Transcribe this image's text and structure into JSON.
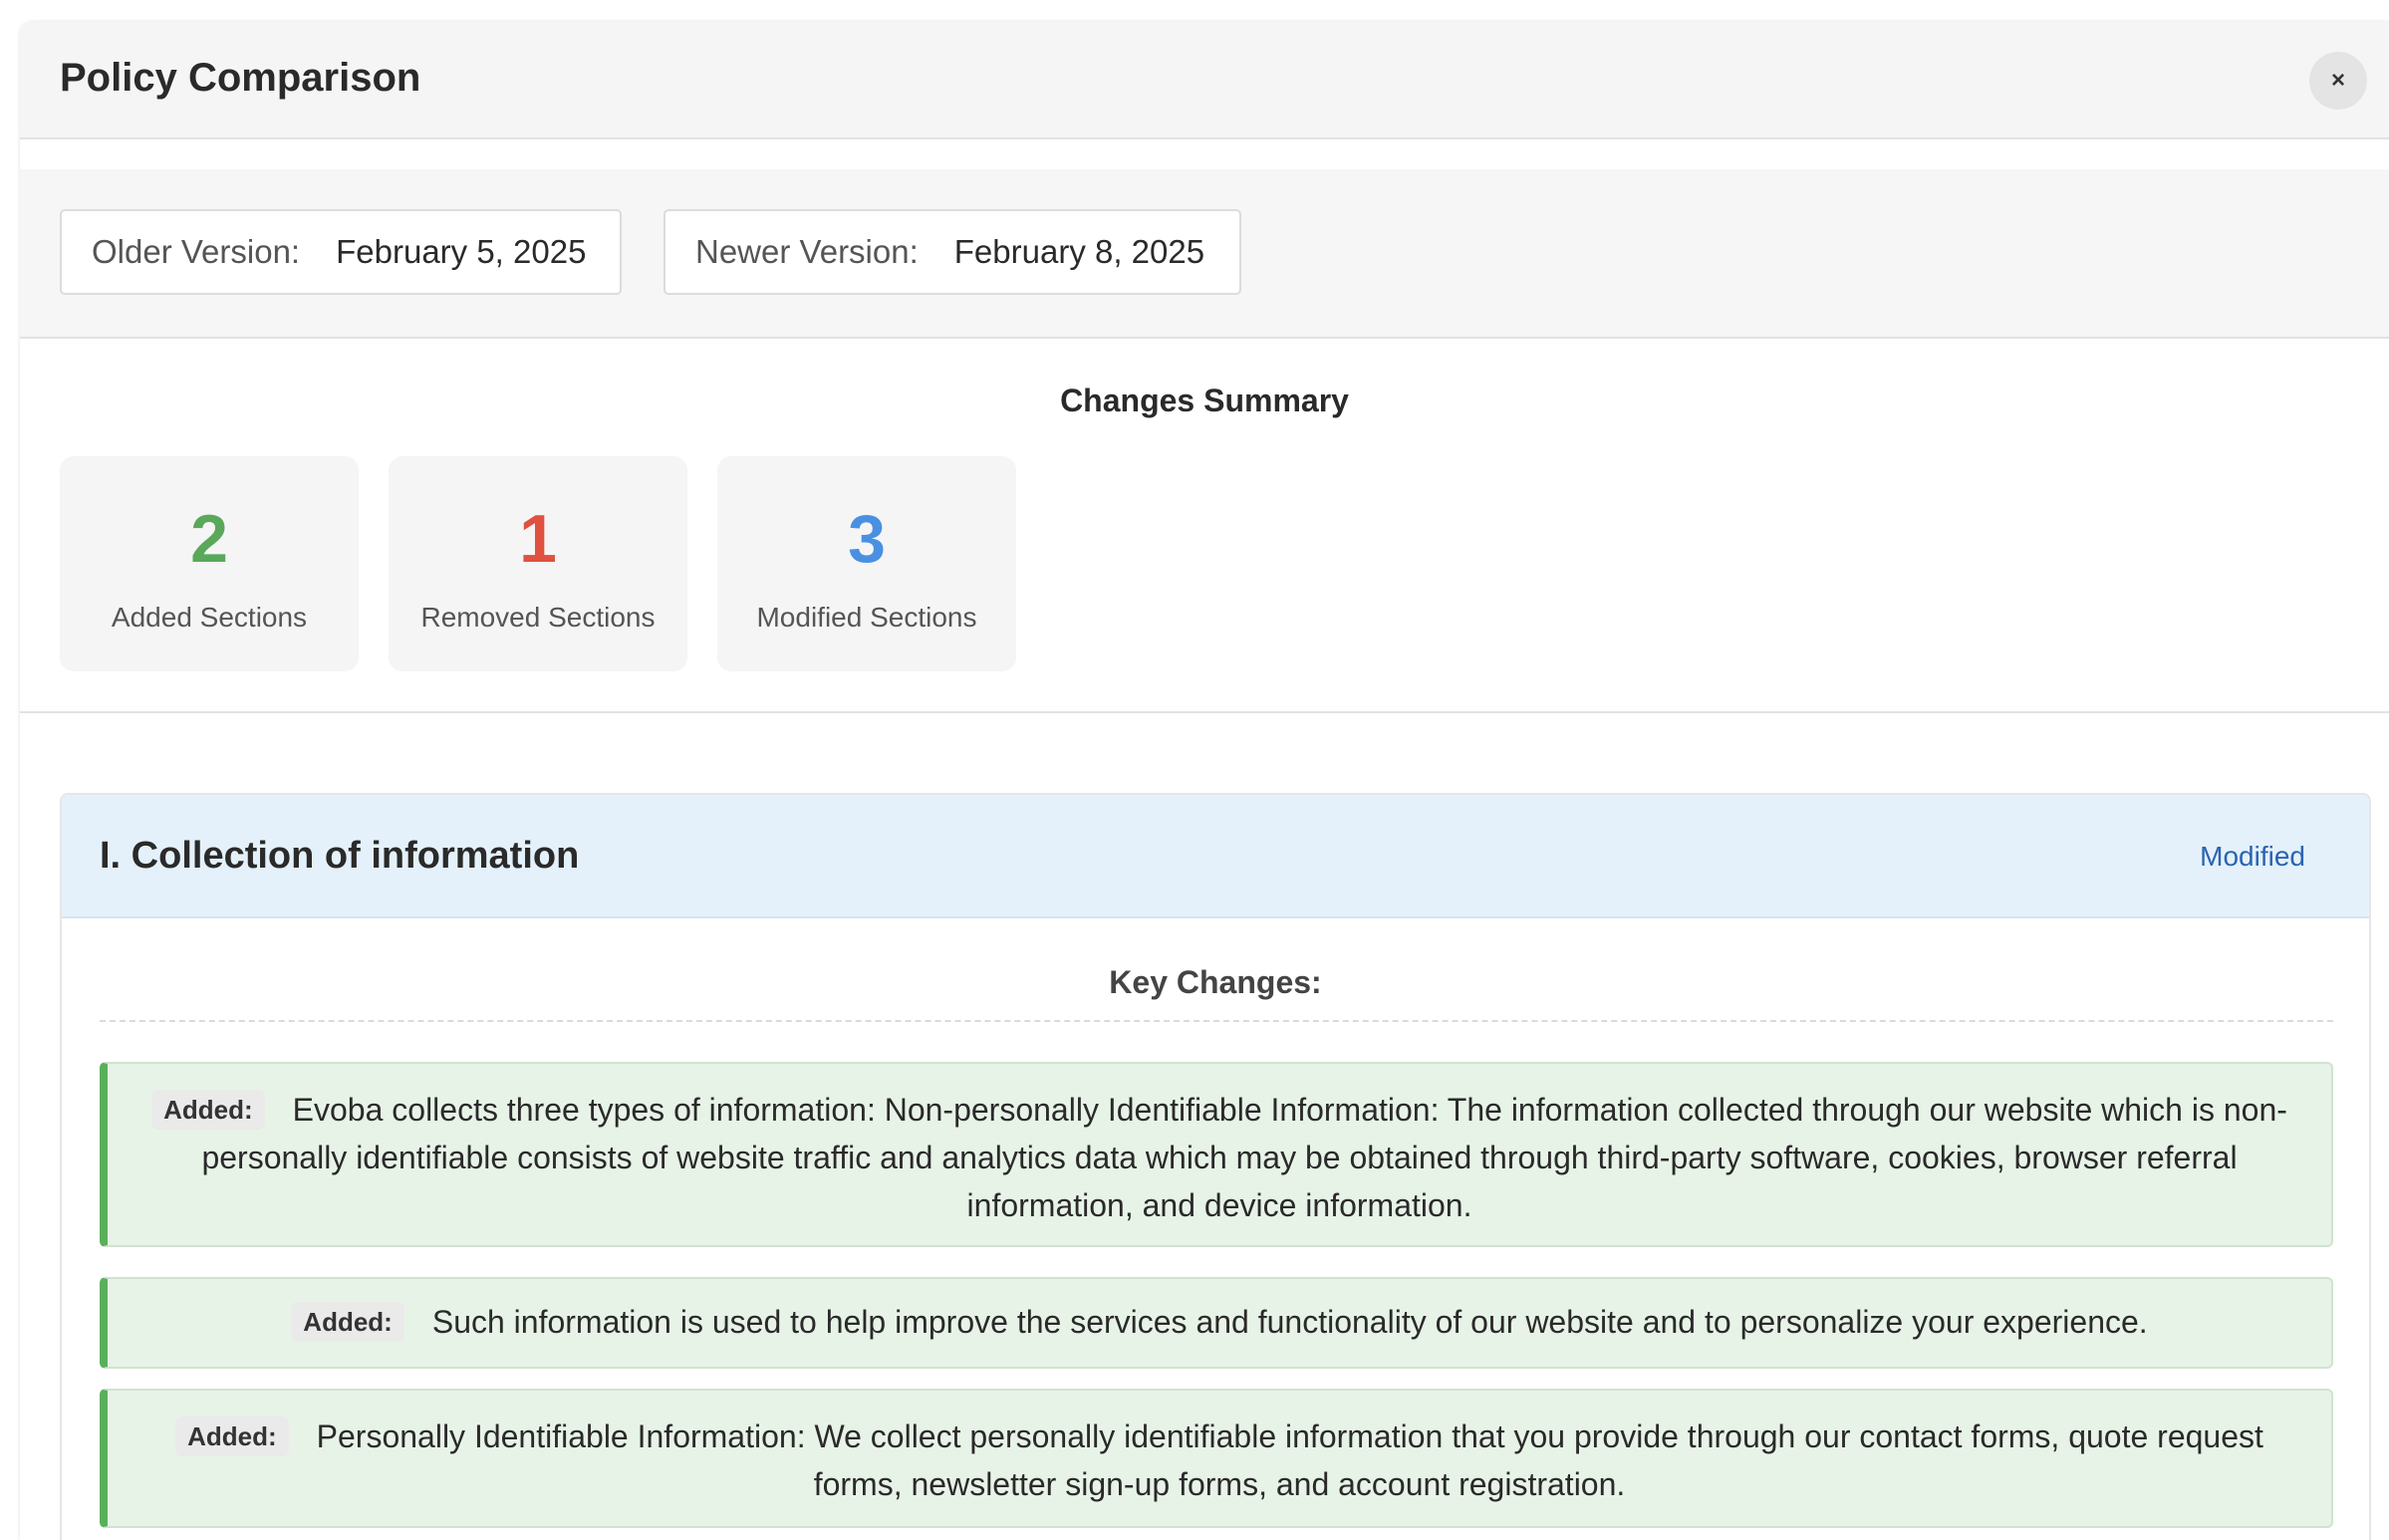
{
  "modal": {
    "title": "Policy Comparison",
    "close_label": "×"
  },
  "versions": {
    "older_label": "Older Version:",
    "older_value": "February 5, 2025",
    "newer_label": "Newer Version:",
    "newer_value": "February 8, 2025"
  },
  "summary": {
    "title": "Changes Summary",
    "stats": [
      {
        "value": "2",
        "label": "Added Sections",
        "color": "#5aa85a"
      },
      {
        "value": "1",
        "label": "Removed Sections",
        "color": "#e0513f"
      },
      {
        "value": "3",
        "label": "Modified Sections",
        "color": "#4a90e2"
      }
    ]
  },
  "section": {
    "title": "I. Collection of information",
    "status": "Modified",
    "key_changes_title": "Key Changes:",
    "changes": [
      {
        "badge": "Added:",
        "text": "Evoba collects three types of information: Non-personally Identifiable Information: The information collected through our website which is non-personally identifiable consists of website traffic and analytics data which may be obtained through third-party software, cookies, browser referral information, and device information."
      },
      {
        "badge": "Added:",
        "text": "Such information is used to help improve the services and functionality of our website and to personalize your experience."
      },
      {
        "badge": "Added:",
        "text": "Personally Identifiable Information: We collect personally identifiable information that you provide through our contact forms, quote request forms, newsletter sign-up forms, and account registration."
      }
    ]
  }
}
